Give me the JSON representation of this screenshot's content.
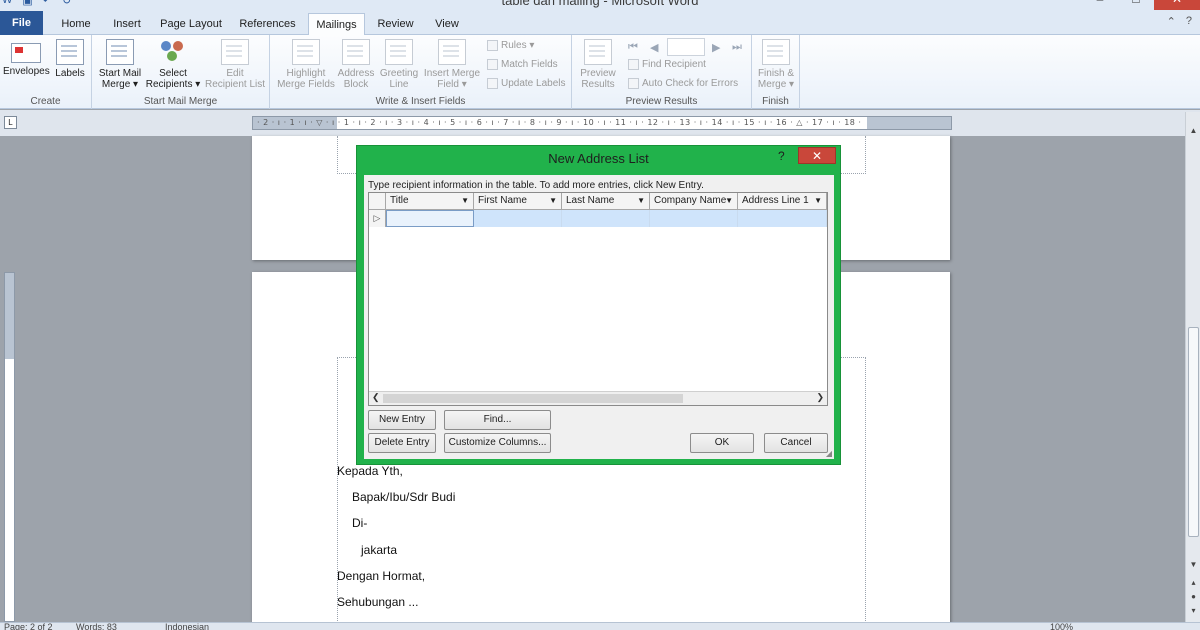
{
  "window": {
    "title": "table dan mailing - Microsoft Word"
  },
  "tabs": [
    "File",
    "Home",
    "Insert",
    "Page Layout",
    "References",
    "Mailings",
    "Review",
    "View"
  ],
  "ribbon": {
    "create": {
      "label": "Create",
      "envelopes": "Envelopes",
      "labels": "Labels"
    },
    "start_mail_merge": {
      "label": "Start Mail Merge",
      "start_line1": "Start Mail",
      "start_line2": "Merge ▾",
      "select_line1": "Select",
      "select_line2": "Recipients ▾",
      "edit_line1": "Edit",
      "edit_line2": "Recipient List"
    },
    "write_insert": {
      "label": "Write & Insert Fields",
      "highlight_line1": "Highlight",
      "highlight_line2": "Merge Fields",
      "address_line1": "Address",
      "address_line2": "Block",
      "greeting_line1": "Greeting",
      "greeting_line2": "Line",
      "insert_line1": "Insert Merge",
      "insert_line2": "Field ▾",
      "rules": "Rules ▾",
      "match": "Match Fields",
      "update": "Update Labels"
    },
    "preview": {
      "label": "Preview Results",
      "preview_line1": "Preview",
      "preview_line2": "Results",
      "find": "Find Recipient",
      "auto_check": "Auto Check for Errors"
    },
    "finish": {
      "label": "Finish",
      "finish_line1": "Finish &",
      "finish_line2": "Merge ▾"
    }
  },
  "ruler": {
    "ticks": "· 2 · ı · 1 · ı · ▽ · ı · 1 · ı · 2 · ı · 3 · ı · 4 · ı · 5 · ı · 6 · ı · 7 · ı · 8 · ı · 9 · ı · 10 · ı · 11 · ı · 12 · ı · 13 · ı · 14 · ı · 15 · ı · 16 · △ · 17 · ı · 18 ·"
  },
  "document": {
    "lines": [
      "Kepada Yth,",
      "Bapak/Ibu/Sdr Budi",
      "Di-",
      "jakarta",
      "Dengan Hormat,",
      "Sehubungan ..."
    ]
  },
  "dialog": {
    "title": "New Address List",
    "help": "?",
    "close": "✕",
    "instruction": "Type recipient information in the table.  To add more entries, click New Entry.",
    "columns": [
      "Title",
      "First Name",
      "Last Name",
      "Company Name",
      "Address Line 1"
    ],
    "row_marker": "▷",
    "buttons": {
      "new_entry": "New Entry",
      "find": "Find...",
      "delete_entry": "Delete Entry",
      "customize": "Customize Columns...",
      "ok": "OK",
      "cancel": "Cancel"
    }
  },
  "status": {
    "page": "Page: 2 of 2",
    "words": "Words: 83",
    "language": "Indonesian",
    "zoom": "100%"
  },
  "colors": {
    "dialog_frame": "#21b24b",
    "close_button": "#c9473a",
    "file_tab": "#2b5797"
  }
}
